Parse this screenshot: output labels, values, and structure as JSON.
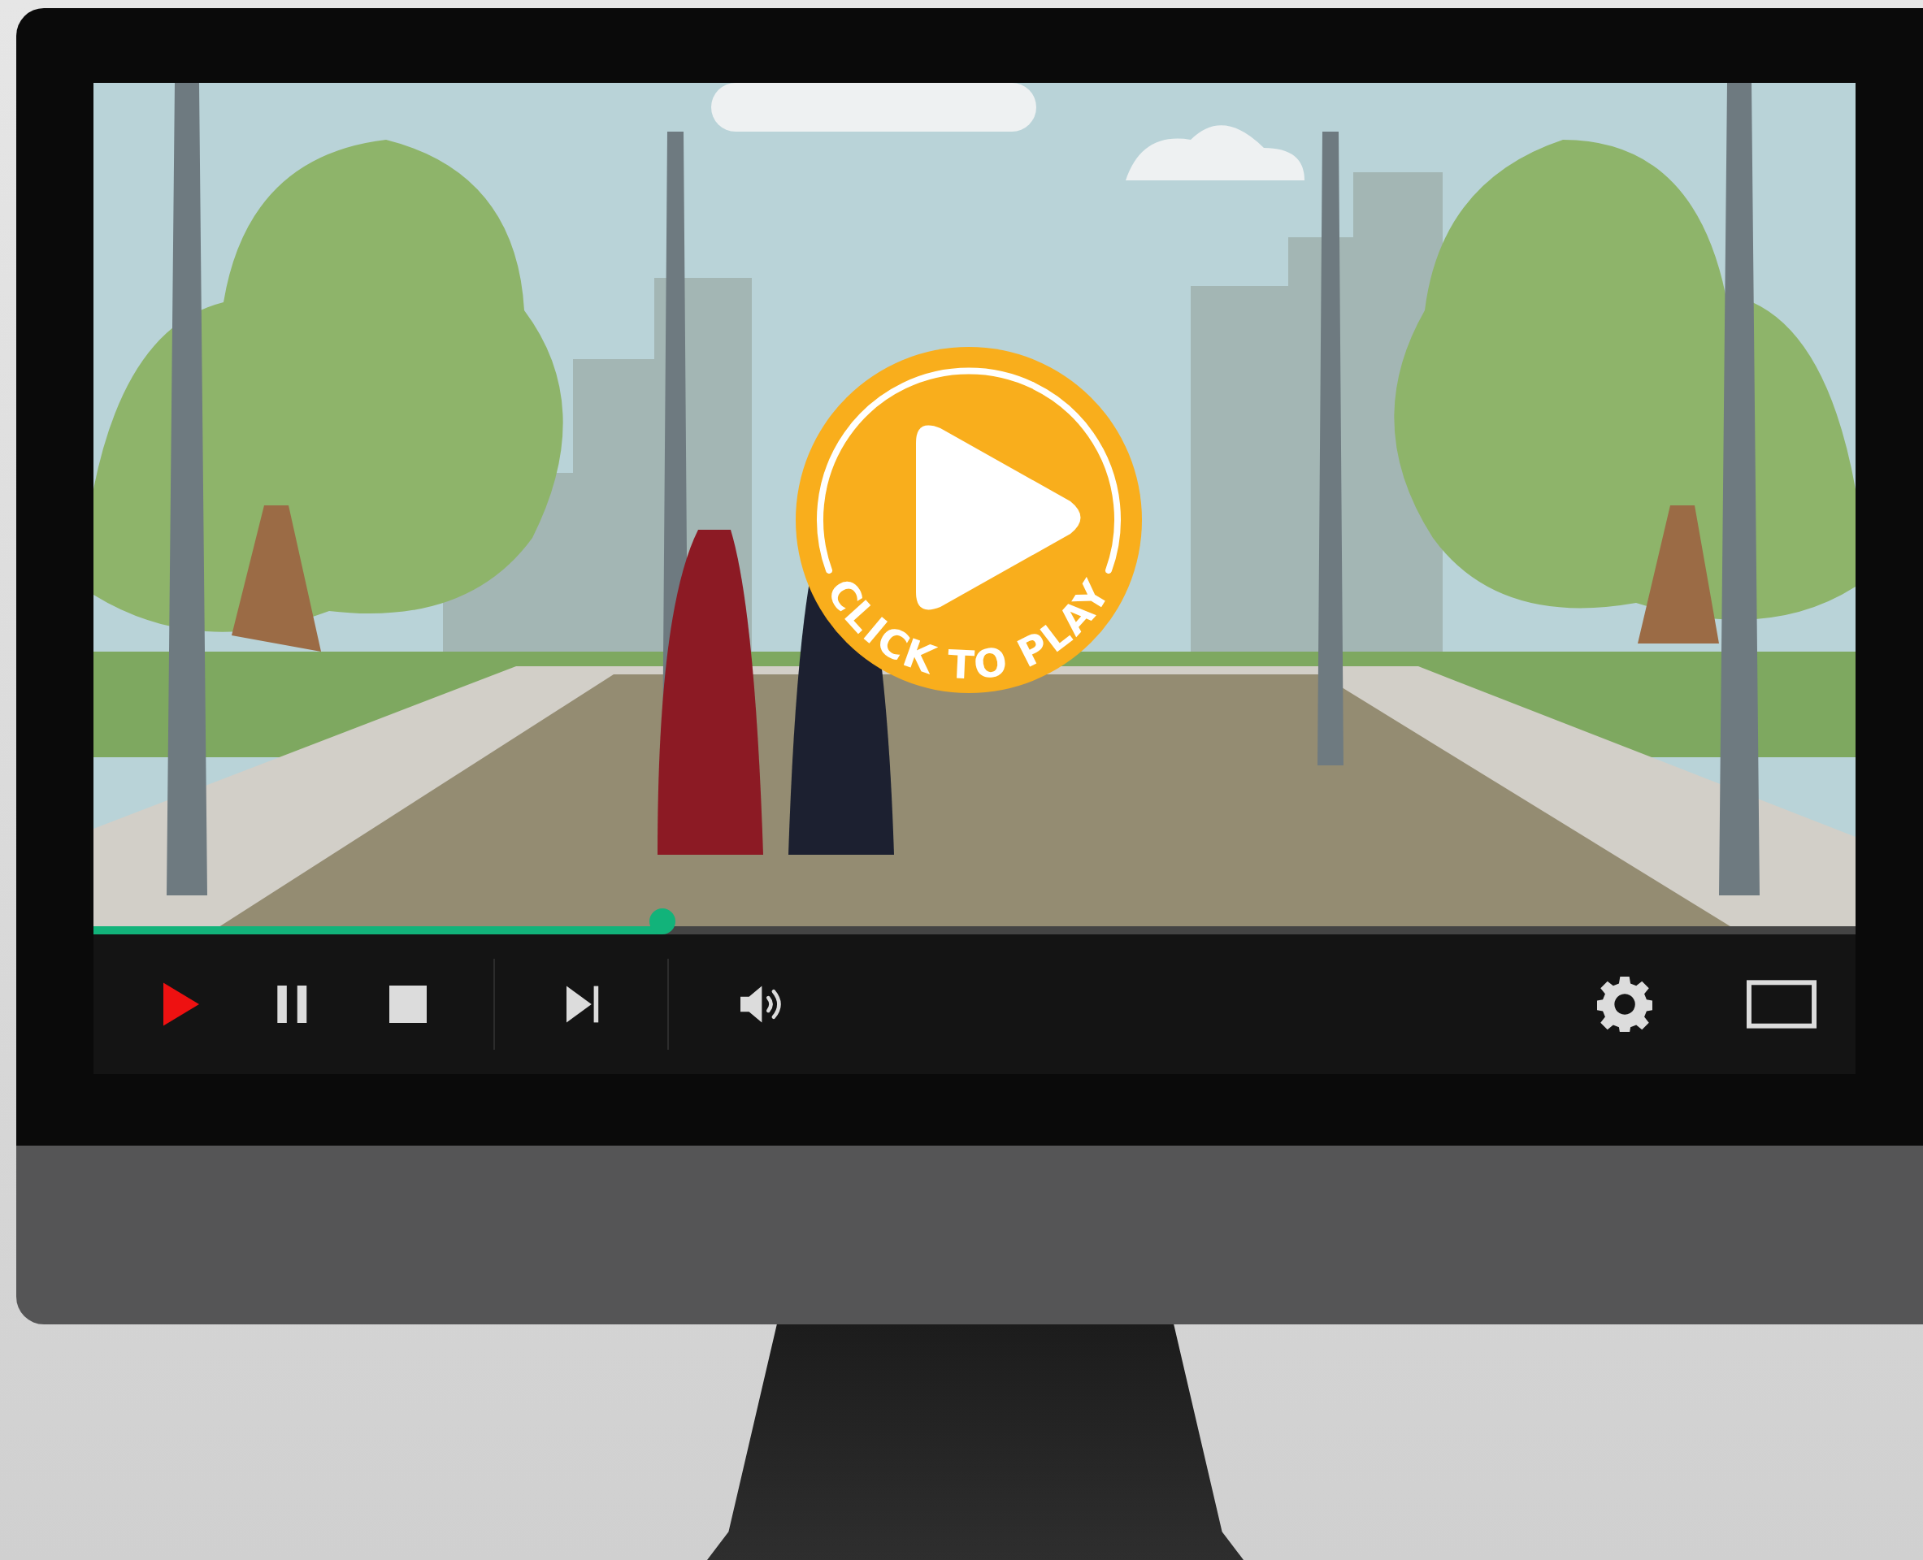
{
  "overlay_button": {
    "label": "CLICK TO PLAY"
  },
  "progress": {
    "level": 0.323
  },
  "controls": [
    {
      "kind": "play",
      "on": true
    },
    {
      "kind": "pause",
      "on": false
    },
    {
      "kind": "stop",
      "on": false
    },
    {
      "kind": "separator"
    },
    {
      "kind": "next",
      "on": false
    },
    {
      "kind": "separator"
    },
    {
      "kind": "volume",
      "on": false
    },
    {
      "kind": "spacer"
    },
    {
      "kind": "settings",
      "on": false
    },
    {
      "kind": "fullscreen",
      "on": false
    }
  ]
}
